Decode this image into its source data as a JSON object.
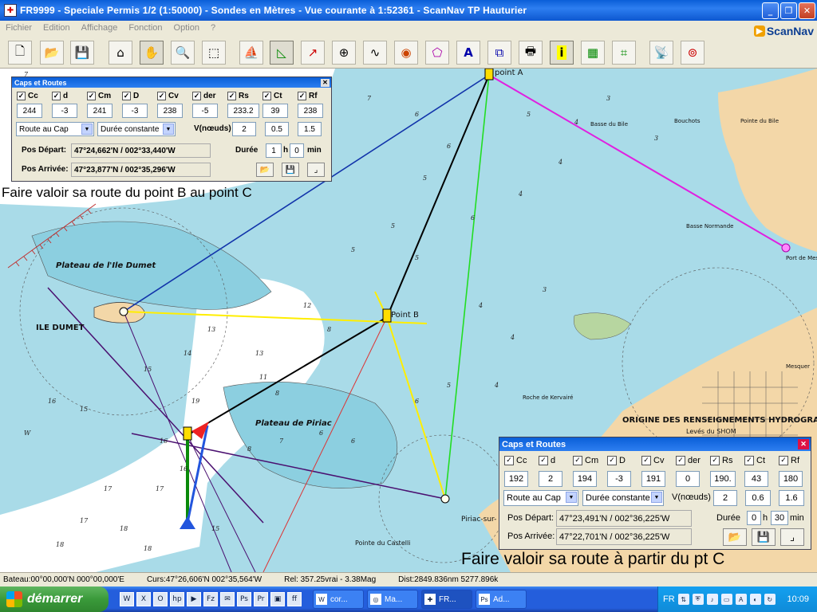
{
  "window": {
    "title": "FR9999 - Speciale Permis 1/2 (1:50000) - Sondes en  Mètres  - Vue courante à 1:52361 - ScanNav TP Hauturier"
  },
  "menu": [
    "Fichier",
    "Edition",
    "Affichage",
    "Fonction",
    "Option",
    "?"
  ],
  "brand": "ScanNav",
  "toolbar_icons": [
    "new-file-icon",
    "open-folder-icon",
    "save-icon",
    "home-icon",
    "hand-icon",
    "zoom-icon",
    "select-rect-icon",
    "boat-icon",
    "route-triangle-icon",
    "route-arrow-icon",
    "target-icon",
    "waypoints-icon",
    "tide-icon",
    "polygon-icon",
    "text-icon",
    "windows-icon",
    "print-icon",
    "info-icon",
    "chart-image-icon",
    "grid-icon",
    "gps-icon",
    "compass-icon"
  ],
  "chart_labels": {
    "point_a": "point A",
    "point_b": "Point B",
    "ile_dumet": "ILE DUMET",
    "plateau_dumet": "Plateau de l'Ile Dumet",
    "plateau_piriac": "Plateau de Piriac",
    "basse_bile": "Basse du Bile",
    "pointe_bile": "Pointe du Bile",
    "port_mesquer": "Port de Mesquer",
    "mesquer": "Mesquer",
    "piriac": "Piriac-sur-",
    "pointe_castelli": "Pointe du Castelli",
    "origine": "ORIGINE DES RENSEIGNEMENTS HYDROGRAPH",
    "leves": "Levés du SHOM",
    "basse_normande": "Basse Normande",
    "roche_kervaire": "Roche de Kervairé",
    "bouchots": "Bouchots"
  },
  "annot_top": "Faire valoir sa route du point B au point C",
  "annot_bottom": "Faire valoir sa route à partir du pt C",
  "dlg_small": {
    "title": "Caps et Routes",
    "fields": [
      {
        "label": "Cc",
        "value": "244"
      },
      {
        "label": "d",
        "value": "-3"
      },
      {
        "label": "Cm",
        "value": "241"
      },
      {
        "label": "D",
        "value": "-3"
      },
      {
        "label": "Cv",
        "value": "238"
      },
      {
        "label": "der",
        "value": "-5"
      },
      {
        "label": "Rs",
        "value": "233.2"
      },
      {
        "label": "Ct",
        "value": "39"
      },
      {
        "label": "Rf",
        "value": "238"
      }
    ],
    "mode": "Route au Cap",
    "duration_mode": "Durée constante",
    "v_label": "V(nœuds)",
    "v1": "2",
    "v2": "0.5",
    "v3": "1.5",
    "pos_dep_label": "Pos Départ:",
    "pos_dep": "47°24,662'N / 002°33,440'W",
    "pos_arr_label": "Pos Arrivée:",
    "pos_arr": "47°23,877'N / 002°35,296'W",
    "duree_label": "Durée",
    "h_value": "1",
    "h_unit": "h",
    "min_value": "0",
    "min_unit": "min"
  },
  "dlg_large": {
    "title": "Caps et Routes",
    "fields": [
      {
        "label": "Cc",
        "value": "192"
      },
      {
        "label": "d",
        "value": "2"
      },
      {
        "label": "Cm",
        "value": "194"
      },
      {
        "label": "D",
        "value": "-3"
      },
      {
        "label": "Cv",
        "value": "191"
      },
      {
        "label": "der",
        "value": "0"
      },
      {
        "label": "Rs",
        "value": "190."
      },
      {
        "label": "Ct",
        "value": "43"
      },
      {
        "label": "Rf",
        "value": "180"
      }
    ],
    "mode": "Route au Cap",
    "duration_mode": "Durée constante",
    "v_label": "V(nœuds)",
    "v1": "2",
    "v2": "0.6",
    "v3": "1.6",
    "pos_dep_label": "Pos Départ:",
    "pos_dep": "47°23,491'N / 002°36,225'W",
    "pos_arr_label": "Pos Arrivée:",
    "pos_arr": "47°22,701'N / 002°36,225'W",
    "duree_label": "Durée",
    "h_value": "0",
    "h_unit": "h",
    "min_value": "30",
    "min_unit": "min"
  },
  "status": {
    "bateau": "Bateau:00°00,000'N 000°00,000'E",
    "curs": "Curs:47°26,606'N 002°35,564'W",
    "rel": "Rel: 357.25vrai - 3.38Mag",
    "dist": "Dist:2849.836nm  5277.896k"
  },
  "taskbar": {
    "start": "démarrer",
    "tasks": [
      "cor...",
      "Ma...",
      "FR...",
      "Ad..."
    ],
    "lang": "FR",
    "clock": "10:09"
  }
}
